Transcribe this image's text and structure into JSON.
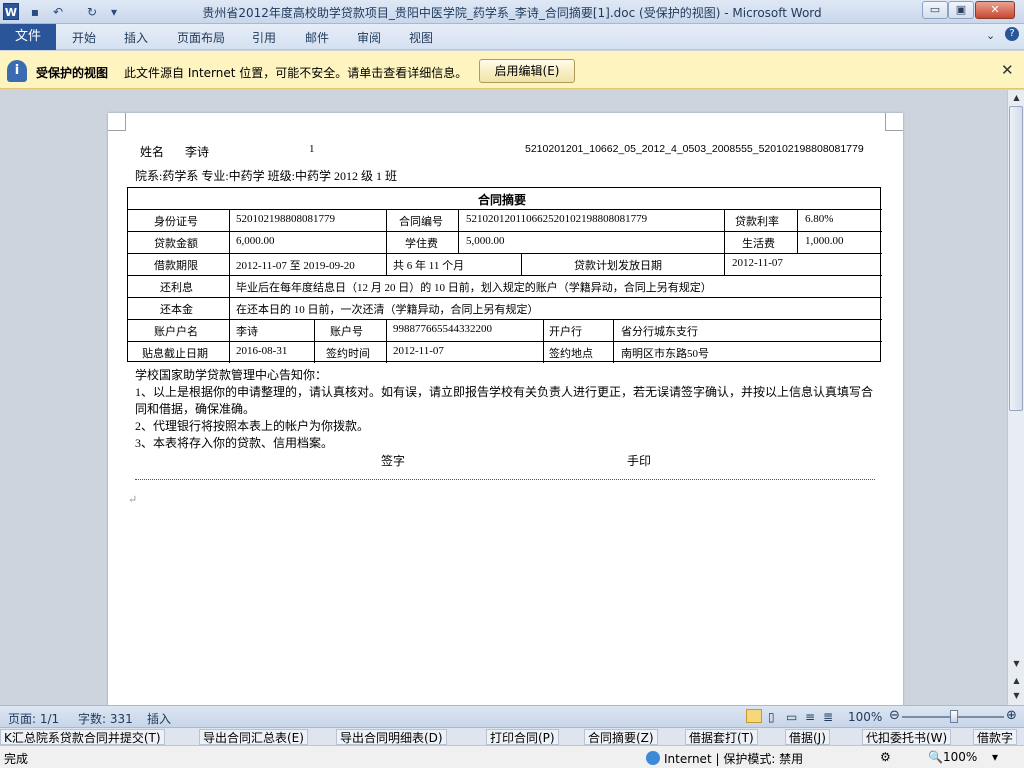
{
  "titlebar": {
    "title": "贵州省2012年度高校助学贷款项目_贵阳中医学院_药学系_李诗_合同摘要[1].doc (受保护的视图) - Microsoft Word",
    "logo": "W",
    "min": "▭",
    "max": "▣",
    "close": "✕"
  },
  "ribbon": {
    "file": "文件",
    "tabs": [
      "开始",
      "插入",
      "页面布局",
      "引用",
      "邮件",
      "审阅",
      "视图"
    ]
  },
  "message_bar": {
    "title": "受保护的视图",
    "text": "此文件源自 Internet 位置，可能不安全。请单击查看详细信息。",
    "button": "启用编辑(E)",
    "close": "✕"
  },
  "doc": {
    "name_label": "姓名",
    "name": "李诗",
    "num": "1",
    "code": "5210201201_10662_05_2012_4_0503_2008555_520102198808081779",
    "dept_line": "院系:药学系    专业:中药学   班级:中药学 2012 级 1 班",
    "table_title": "合同摘要",
    "id_label": "身份证号",
    "id_value": "520102198808081779",
    "contract_label": "合同编号",
    "contract_value": "52102012011066252010219880808177​9",
    "rate_label": "贷款利率",
    "rate_value": "6.80%",
    "amount_label": "贷款金额",
    "amount_value": "6,000.00",
    "tuition_label": "学住费",
    "tuition_value": "5,000.00",
    "living_label": "生活费",
    "living_value": "1,000.00",
    "term_label": "借款期限",
    "term_value": "2012-11-07 至 2019-09-20",
    "term_len": "共 6 年 11 个月",
    "plan_label": "贷款计划发放日期",
    "plan_value": "2012-11-07",
    "interest_label": "还利息",
    "interest_value": "毕业后在每年度结息日（12 月 20 日）的 10 日前，划入规定的账户（学籍异动，合同上另有规定）",
    "principal_label": "还本金",
    "principal_value": "在还本日的 10 日前，一次还清（学籍异动，合同上另有规定）",
    "holder_label": "账户户名",
    "holder_value": "李诗",
    "account_label": "账户号",
    "account_value": "998877665544332200",
    "bank_label": "开户行",
    "bank_value": "省分行城东支行",
    "cutoff_label": "贴息截止日期",
    "cutoff_value": "2016-08-31",
    "sign_time_label": "签约时间",
    "sign_time_value": "2012-11-07",
    "sign_place_label": "签约地点",
    "sign_place_value": "南明区市东路50号",
    "notice": "学校国家助学贷款管理中心告知你：",
    "line1": "1、以上是根据你的申请整理的，请认真核对。如有误，请立即报告学校有关负责人进行更正，若无误请签字确认，并按以上信息认真填写合",
    "line1b": "同和借据，确保准确。",
    "line2": "2、代理银行将按照本表上的帐户为你拨款。",
    "line3": "3、本表将存入你的贷款、信用档案。",
    "sign": "签字",
    "seal": "手印",
    "mark": "↵"
  },
  "status": {
    "page": "页面: 1/1",
    "words": "字数: 331",
    "mode": "插入",
    "zoom": "100%"
  },
  "taskbar": [
    "K汇总院系贷款合同并提交(T)",
    "导出合同汇总表(E)",
    "导出合同明细表(D)",
    "打印合同(P)",
    "合同摘要(Z)",
    "借据套打(T)",
    "借据(J)",
    "代扣委托书(W)",
    "借款字"
  ],
  "ie_status": {
    "done": "完成",
    "zone": "Internet | 保护模式: 禁用",
    "zoom": "100%"
  }
}
